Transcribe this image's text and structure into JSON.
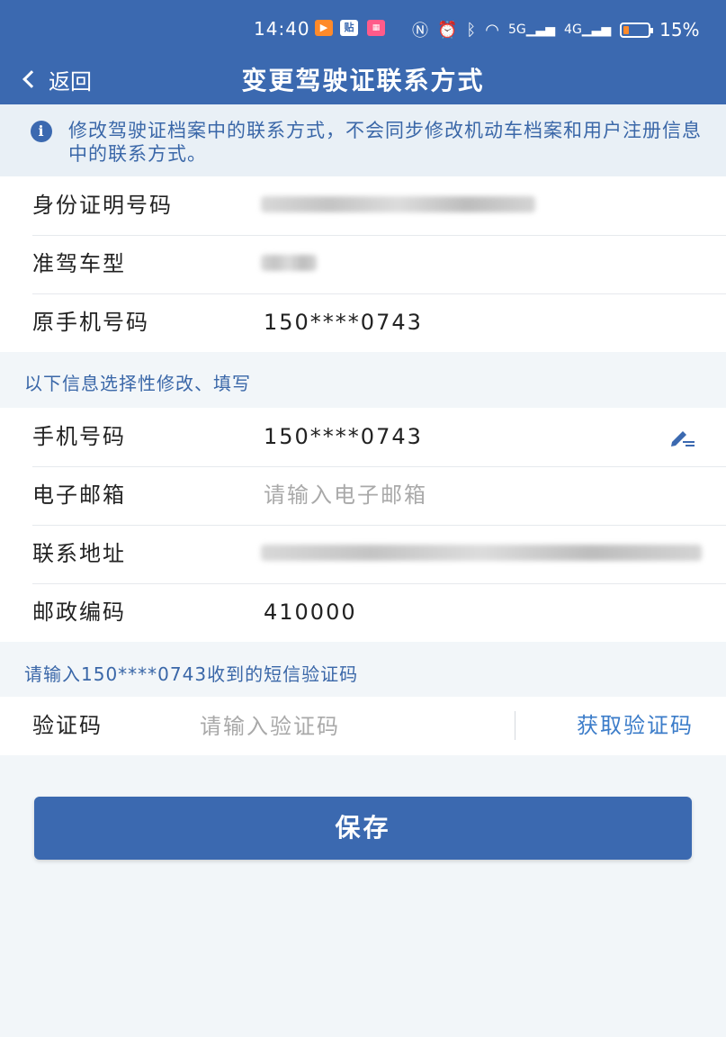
{
  "status_bar": {
    "time": "14:40",
    "battery": "15%",
    "signal_labels": [
      "5G",
      "4G"
    ]
  },
  "navbar": {
    "back_label": "返回",
    "title": "变更驾驶证联系方式"
  },
  "notice": {
    "text": "修改驾驶证档案中的联系方式，不会同步修改机动车档案和用户注册信息中的联系方式。"
  },
  "info_rows": [
    {
      "label": "身份证明号码",
      "value": ""
    },
    {
      "label": "准驾车型",
      "value": ""
    },
    {
      "label": "原手机号码",
      "value": "150****0743"
    }
  ],
  "optional_section_title": "以下信息选择性修改、填写",
  "form": {
    "phone": {
      "label": "手机号码",
      "value": "150****0743"
    },
    "email": {
      "label": "电子邮箱",
      "placeholder": "请输入电子邮箱"
    },
    "address": {
      "label": "联系地址",
      "value": ""
    },
    "postcode": {
      "label": "邮政编码",
      "value": "410000"
    }
  },
  "sms_section_title": "请输入150****0743收到的短信验证码",
  "verify": {
    "label": "验证码",
    "placeholder": "请输入验证码",
    "get_code_label": "获取验证码"
  },
  "save_label": "保存",
  "colors": {
    "primary": "#3b69b0",
    "link": "#3b7cc9",
    "background": "#f2f6f9"
  }
}
